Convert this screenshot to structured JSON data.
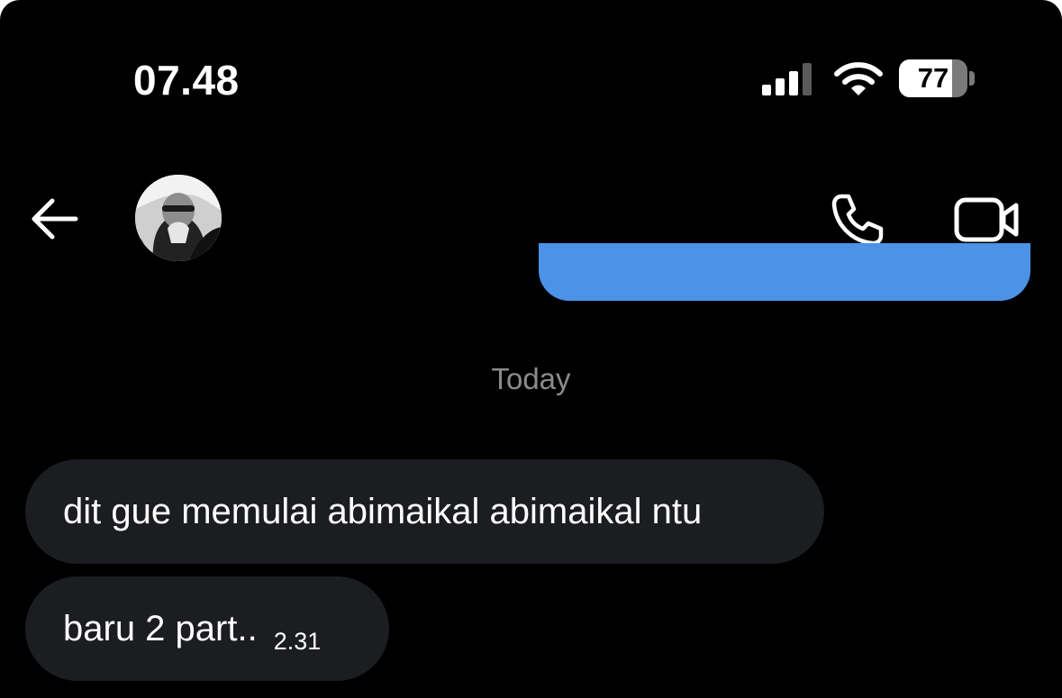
{
  "status_bar": {
    "time": "07.48",
    "battery_level": "77",
    "battery_fraction": 0.77,
    "icons": [
      "signal-icon",
      "wifi-icon",
      "battery-icon"
    ]
  },
  "header": {
    "icons": [
      "back-arrow-icon",
      "avatar",
      "phone-icon",
      "video-camera-icon"
    ]
  },
  "colors": {
    "background": "#000000",
    "sent_bubble": "#4c92e6",
    "received_bubble": "#1c1d20",
    "date_separator": "#8b8b8b"
  },
  "conversation": {
    "date_separator": "Today",
    "messages": [
      {
        "text": "dit gue memulai abimaikal abimaikal ntu"
      },
      {
        "text": "baru 2 part..",
        "time": "2.31"
      }
    ]
  }
}
